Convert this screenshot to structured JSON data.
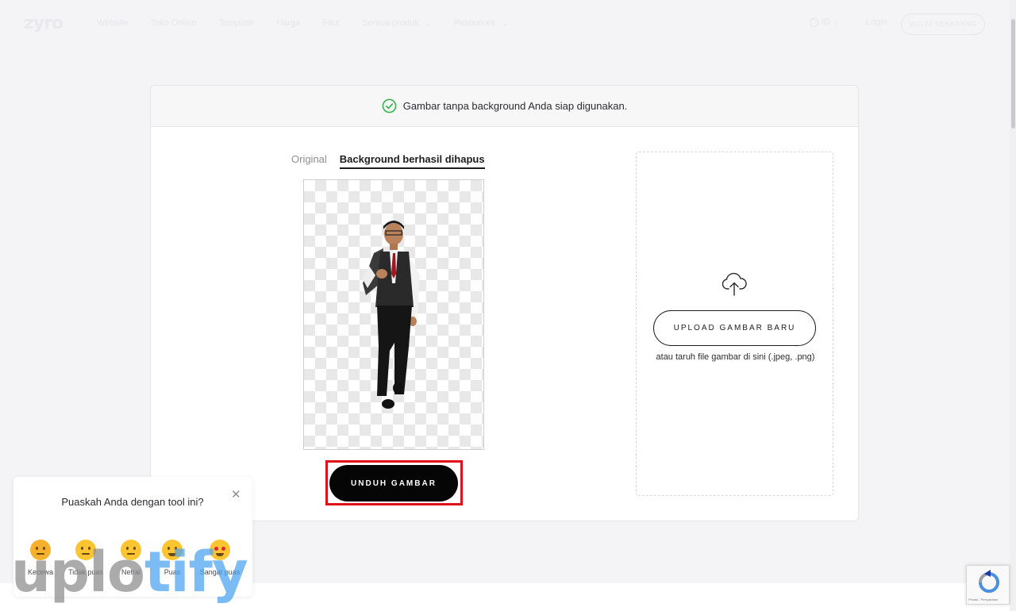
{
  "nav": {
    "logo": "zyro",
    "links": [
      "Website",
      "Toko Online",
      "Template",
      "Harga",
      "Fitur",
      "Semua produk",
      "Resources"
    ],
    "lang": "ID",
    "login": "Login",
    "start": "MULAI SEKARANG"
  },
  "card": {
    "status": "Gambar tanpa background Anda siap digunakan.",
    "tabs": {
      "original": "Original",
      "removed": "Background berhasil dihapus"
    },
    "download": "UNDUH GAMBAR",
    "upload": "UPLOAD GAMBAR BARU",
    "upload_hint": "atau taruh file gambar di sini (.jpeg, .png)"
  },
  "feedback": {
    "question": "Puaskah Anda dengan tool ini?",
    "options": [
      "Kecewa",
      "Tidak puas",
      "Netral",
      "Puas",
      "Sangat puas"
    ]
  },
  "watermark": {
    "part1": "uplo",
    "part2": "tify"
  },
  "recaptcha": "Privasi - Persyaratan",
  "colors": {
    "accent_red": "#e0101b",
    "success_green": "#2fb344",
    "button_black": "#050505"
  }
}
